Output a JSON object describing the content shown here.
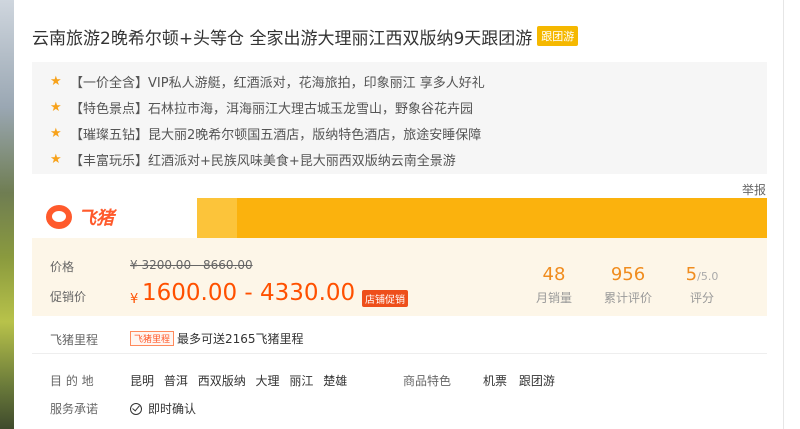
{
  "product": {
    "title": "云南旅游2晚希尔顿+头等仓 全家出游大理丽江西双版纳9天跟团游",
    "tag": "跟团游"
  },
  "highlights": [
    "【一价全含】VIP私人游艇，红酒派对，花海旅拍，印象丽江 享多人好礼",
    "【特色景点】石林拉市海，洱海丽江大理古城玉龙雪山，野象谷花卉园",
    "【璀璨五钻】昆大丽2晚希尔顿国五酒店，版纳特色酒店，旅途安睡保障",
    "【丰富玩乐】红酒派对+民族风味美食+昆大丽西双版纳云南全景游"
  ],
  "report_label": "举报",
  "brand": {
    "logo_text": "飞猪"
  },
  "price": {
    "original_label": "价格",
    "original_value": "¥ 3200.00 - 8660.00",
    "promo_label": "促销价",
    "promo_currency": "¥",
    "promo_value": "1600.00 - 4330.00",
    "promo_tag": "店铺促销"
  },
  "stats": {
    "monthly_sales": {
      "value": "48",
      "label": "月销量"
    },
    "reviews": {
      "value": "956",
      "label": "累计评价"
    },
    "rating": {
      "value": "5",
      "max": "/5.0",
      "label": "评分"
    }
  },
  "mileage": {
    "label": "飞猪里程",
    "tag": "飞猪里程",
    "text": "最多可送2165飞猪里程"
  },
  "destinations": {
    "label": "目 的 地",
    "items": [
      "昆明",
      "普洱",
      "西双版纳",
      "大理",
      "丽江",
      "楚雄"
    ]
  },
  "features": {
    "label": "商品特色",
    "items": [
      "机票",
      "跟团游"
    ]
  },
  "service": {
    "label": "服务承诺",
    "item": "即时确认"
  },
  "colors": {
    "accent_orange": "#ff5000",
    "banner_yellow": "#fbb20d",
    "stat_orange": "#f08c1e",
    "star": "#f7a21b"
  }
}
